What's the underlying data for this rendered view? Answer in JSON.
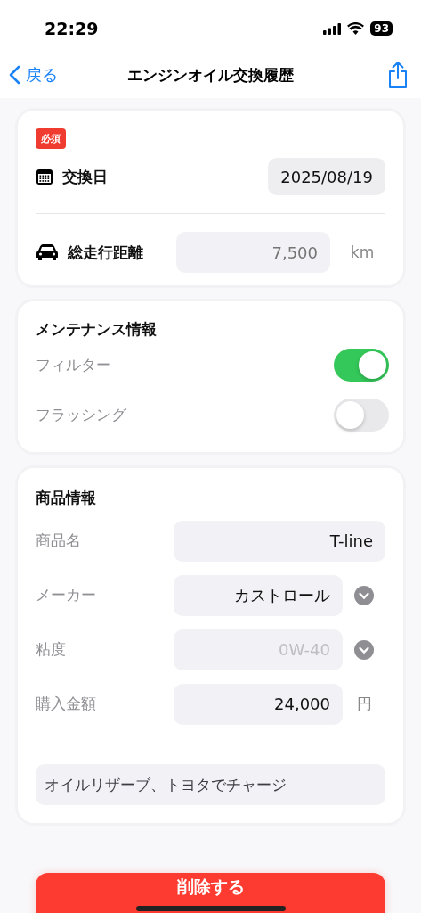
{
  "status_bar": {
    "time": "22:29",
    "battery": "93"
  },
  "nav": {
    "back": "戻る",
    "title": "エンジンオイル交換履歴"
  },
  "basic": {
    "badge": "必須",
    "date_label": "交換日",
    "date": "2025/08/19",
    "mileage_label": "総走行距離",
    "mileage_placeholder": "7,500",
    "mileage_unit": "km"
  },
  "maintenance": {
    "title": "メンテナンス情報",
    "toggles": [
      {
        "label": "フィルター",
        "on": true
      },
      {
        "label": "フラッシング",
        "on": false
      }
    ]
  },
  "product": {
    "title": "商品情報",
    "rows": [
      {
        "kind": "text",
        "label": "商品名",
        "value": "T-line"
      },
      {
        "kind": "picker",
        "label": "メーカー",
        "value": "カストロール"
      },
      {
        "kind": "picker",
        "label": "粘度",
        "placeholder": "0W-40"
      },
      {
        "kind": "unit",
        "label": "購入金額",
        "value": "24,000",
        "unit": "円"
      }
    ],
    "memo": "オイルリザーブ、トヨタでチャージ"
  },
  "delete_button": "削除する"
}
